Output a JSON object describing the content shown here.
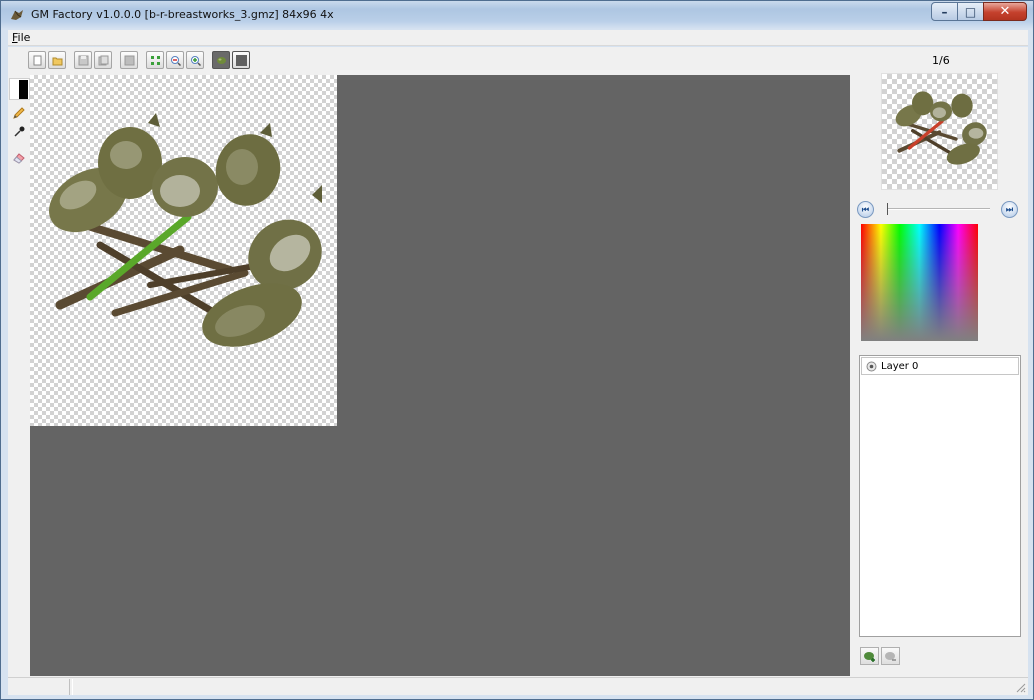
{
  "window": {
    "title": "GM Factory v1.0.0.0 [b-r-breastworks_3.gmz] 84x96 4x",
    "minimize_glyph": "–",
    "maximize_glyph": "□",
    "close_glyph": "✕"
  },
  "menu": {
    "file_accel": "F",
    "file_rest": "ile"
  },
  "toolbar": {
    "buttons": [
      "new-icon",
      "open-icon",
      "save-icon",
      "save-as-icon",
      "blank-icon",
      "grid-icon",
      "zoom-out-icon",
      "zoom-in-icon",
      "sprite-view-icon",
      "background-icon"
    ]
  },
  "tools": [
    "pencil-icon",
    "color-picker-icon",
    "eraser-icon"
  ],
  "colors": {
    "foreground": "#000000",
    "background": "#ffffff",
    "canvas_bg": "#646464",
    "accent": "#4f7fbf"
  },
  "frames": {
    "label": "1/6",
    "current": 1,
    "total": 6
  },
  "navigation": {
    "prev_glyph": "⏮",
    "next_glyph": "⏭"
  },
  "layers": [
    {
      "name": "Layer 0",
      "visible": true
    }
  ]
}
